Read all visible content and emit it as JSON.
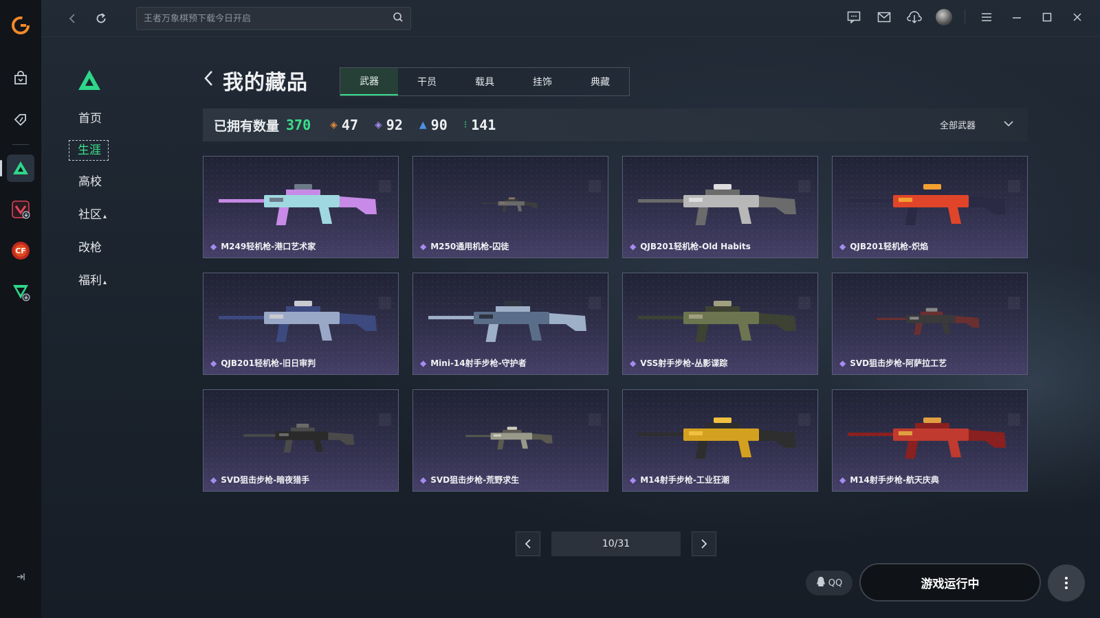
{
  "search": {
    "placeholder": "王者万象棋预下载今日开启"
  },
  "sidebar": {
    "items": [
      {
        "label": "首页",
        "caret": ""
      },
      {
        "label": "生涯",
        "caret": ""
      },
      {
        "label": "高校",
        "caret": ""
      },
      {
        "label": "社区",
        "caret": "^"
      },
      {
        "label": "改枪",
        "caret": ""
      },
      {
        "label": "福利",
        "caret": "^"
      }
    ],
    "active_index": 1
  },
  "page": {
    "title": "我的藏品"
  },
  "tabs": [
    {
      "label": "武器",
      "active": true
    },
    {
      "label": "干员",
      "active": false
    },
    {
      "label": "载具",
      "active": false
    },
    {
      "label": "挂饰",
      "active": false
    },
    {
      "label": "典藏",
      "active": false
    }
  ],
  "stats": {
    "owned_label": "已拥有数量",
    "owned_value": "370",
    "rarities": [
      {
        "color": "#e08a3c",
        "value": "47"
      },
      {
        "color": "#a58cf0",
        "value": "92"
      },
      {
        "color": "#4f8fe8",
        "value": "90"
      },
      {
        "color": "#3be08b",
        "value": "141"
      }
    ],
    "filter_label": "全部武器"
  },
  "items": [
    {
      "name": "M249轻机枪-港口艺术家",
      "palette": [
        "#9fd8e0",
        "#c78ae6",
        "#6d7a8a"
      ],
      "scale": 1.0
    },
    {
      "name": "M250通用机枪-囚徒",
      "palette": [
        "#6a6a6a",
        "#3d3d3d",
        "#8a7a60"
      ],
      "scale": 0.35
    },
    {
      "name": "QJB201轻机枪-Old Habits",
      "palette": [
        "#b8b8b8",
        "#6b6b6b",
        "#dddddd"
      ],
      "scale": 1.0
    },
    {
      "name": "QJB201轻机枪-炽焰",
      "palette": [
        "#e0452a",
        "#2b2a45",
        "#f2a030"
      ],
      "scale": 1.0
    },
    {
      "name": "QJB201轻机枪-旧日审判",
      "palette": [
        "#9aa8c8",
        "#3d4a80",
        "#c9c9d0"
      ],
      "scale": 1.0
    },
    {
      "name": "Mini-14射手步枪-守护者",
      "palette": [
        "#5a6e8a",
        "#9eb0c8",
        "#2e3440"
      ],
      "scale": 1.0
    },
    {
      "name": "VSS射手步枪-丛影谍踪",
      "palette": [
        "#6d7550",
        "#3e4232",
        "#a0a080"
      ],
      "scale": 1.0
    },
    {
      "name": "SVD狙击步枪-阿萨拉工艺",
      "palette": [
        "#3a3a3a",
        "#6a3030",
        "#888888"
      ],
      "scale": 0.65
    },
    {
      "name": "SVD狙击步枪-暗夜猎手",
      "palette": [
        "#2a2a2a",
        "#4a4a4a",
        "#6a6a6a"
      ],
      "scale": 0.7
    },
    {
      "name": "SVD狙击步枪-荒野求生",
      "palette": [
        "#9a9a8a",
        "#5a5a50",
        "#cfcfc0"
      ],
      "scale": 0.55
    },
    {
      "name": "M14射手步枪-工业狂潮",
      "palette": [
        "#d4a020",
        "#2e2e2e",
        "#f0c040"
      ],
      "scale": 1.0
    },
    {
      "name": "M14射手步枪-航天庆典",
      "palette": [
        "#c03a30",
        "#8a2020",
        "#e0a040"
      ],
      "scale": 1.0
    }
  ],
  "pagination": {
    "label": "10/31"
  },
  "footer": {
    "qq_label": "QQ",
    "play_label": "游戏运行中"
  }
}
